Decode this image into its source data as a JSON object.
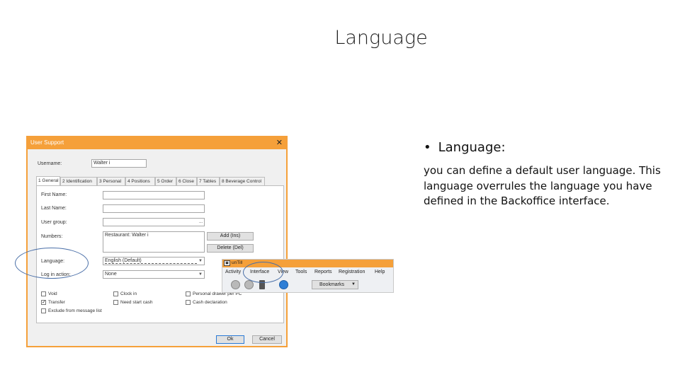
{
  "slide": {
    "title": "Language",
    "bullet": "Language:",
    "body": "you can  define a default user language. This language overrules the language you have defined in the Backoffice interface."
  },
  "dialog": {
    "title": "User Support",
    "username_label": "Username:",
    "username_value": "Walter i",
    "tabs": [
      "1 General",
      "2 Identification",
      "3 Personal",
      "4 Positions",
      "5 Order",
      "6 Close",
      "7 Tables",
      "8 Beverage Control"
    ],
    "fields": {
      "first_name": "First Name:",
      "last_name": "Last Name:",
      "user_group": "User group:",
      "user_group_btn": "...",
      "numbers": "Numbers:",
      "numbers_value": "Restaurant: Walter i",
      "add_btn": "Add (Ins)",
      "delete_btn": "Delete (Del)",
      "language": "Language:",
      "language_value": "English (Default)",
      "login_action": "Log in action:",
      "login_action_value": "None"
    },
    "checkboxes": [
      {
        "label": "Void",
        "checked": false
      },
      {
        "label": "Clock in",
        "checked": false
      },
      {
        "label": "Personal drawer per PC",
        "checked": false
      },
      {
        "label": "Transfer",
        "checked": true
      },
      {
        "label": "Need start cash",
        "checked": false
      },
      {
        "label": "Cash declaration",
        "checked": false
      },
      {
        "label": "Exclude from message list",
        "checked": false
      }
    ],
    "ok_btn": "Ok",
    "cancel_btn": "Cancel"
  },
  "menu": {
    "app_title": "unTill",
    "items": [
      "Activity",
      "Interface",
      "View",
      "Tools",
      "Reports",
      "Registration",
      "Help"
    ],
    "bookmarks": "Bookmarks"
  },
  "colors": {
    "accent": "#f5a03a",
    "highlight": "#4a6fa8"
  }
}
